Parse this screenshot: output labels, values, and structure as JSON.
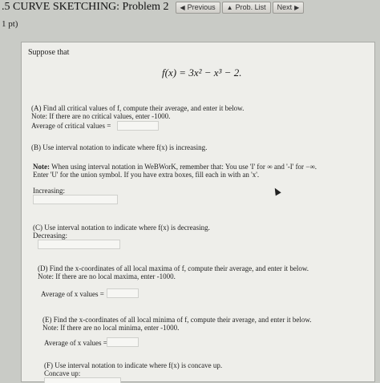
{
  "header": {
    "title": ".5 CURVE SKETCHING: Problem 2",
    "nav": [
      {
        "label": "Previous",
        "icon": "triangle-left-icon"
      },
      {
        "label": "Prob. List",
        "icon": "triangle-up-icon"
      },
      {
        "label": "Next",
        "icon": "triangle-right-icon"
      }
    ]
  },
  "points": "1 pt)",
  "problem": {
    "intro": "Suppose that",
    "equation": "f(x) = 3x² − x³ − 2.",
    "a_line1": "(A) Find all critical values of f, compute their average, and enter it below.",
    "a_line2": "Note: If there are no critical values, enter -1000.",
    "a_label": "Average of critical values =",
    "b_line": "(B) Use interval notation to indicate where f(x) is increasing.",
    "note_bold": "Note:",
    "note_line1": " When using interval notation in WeBWorK, remember that: You use 'I' for ∞ and '-I' for −∞.",
    "note_line2": "Enter 'U' for the union symbol. If you have extra boxes, fill each in with an 'x'.",
    "increasing_label": "Increasing:",
    "c_line": "(C) Use interval notation to indicate where f(x) is decreasing.",
    "decreasing_label": "Decreasing:",
    "d_line1": "(D) Find the x-coordinates of all local maxima of f, compute their average, and enter it below.",
    "d_line2": "Note: If there are no local maxima, enter -1000.",
    "d_label": "Average of x values =",
    "e_line1": "(E) Find the x-coordinates of all local minima of f, compute their average, and enter it below.",
    "e_line2": "Note: If there are no local minima, enter -1000.",
    "e_label": "Average of x values =",
    "f_line": "(F) Use interval notation to indicate where f(x) is concave up.",
    "concave_up_label": "Concave up:"
  }
}
